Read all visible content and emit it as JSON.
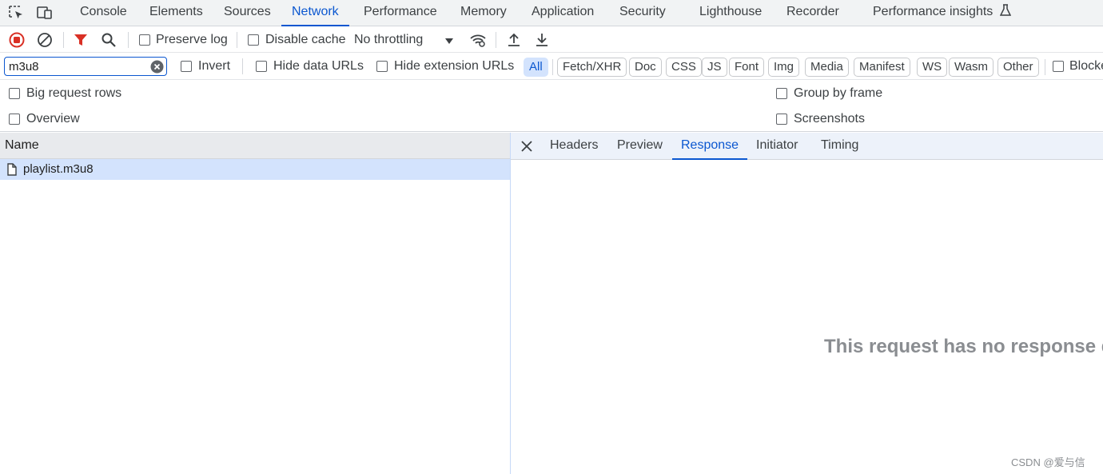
{
  "tabs": {
    "items": [
      "Console",
      "Elements",
      "Sources",
      "Network",
      "Performance",
      "Memory",
      "Application",
      "Security",
      "Lighthouse",
      "Recorder",
      "Performance insights"
    ],
    "active": "Network"
  },
  "toolbar": {
    "preserve_log": "Preserve log",
    "disable_cache": "Disable cache",
    "throttling": "No throttling"
  },
  "filter": {
    "value": "m3u8",
    "invert": "Invert",
    "hide_data_urls": "Hide data URLs",
    "hide_extension_urls": "Hide extension URLs",
    "types": [
      "All",
      "Fetch/XHR",
      "Doc",
      "CSS",
      "JS",
      "Font",
      "Img",
      "Media",
      "Manifest",
      "WS",
      "Wasm",
      "Other"
    ],
    "active_type": "All",
    "blocked": "Blocke"
  },
  "options": {
    "big_request_rows": "Big request rows",
    "overview": "Overview",
    "group_by_frame": "Group by frame",
    "screenshots": "Screenshots"
  },
  "requests": {
    "column_name": "Name",
    "rows": [
      {
        "name": "playlist.m3u8"
      }
    ]
  },
  "detail": {
    "tabs": [
      "Headers",
      "Preview",
      "Response",
      "Initiator",
      "Timing"
    ],
    "active": "Response",
    "message": "This request has no response d"
  },
  "watermark": "CSDN @爱与信",
  "colors": {
    "accent": "#0b57d0",
    "record": "#d93025",
    "filter_icon": "#d93025",
    "selected_row": "#d3e3fd"
  }
}
